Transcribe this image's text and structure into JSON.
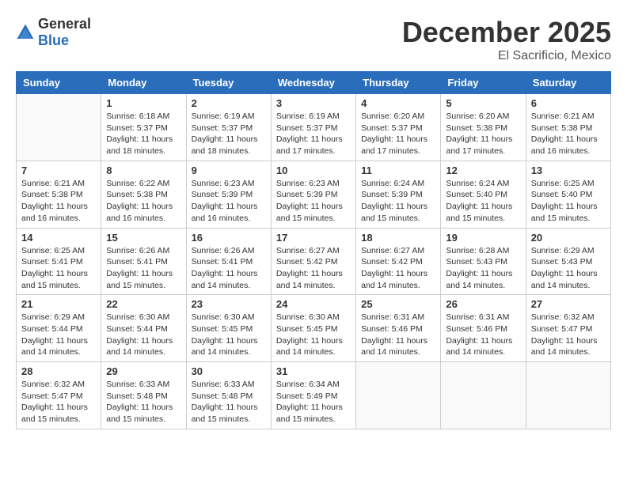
{
  "logo": {
    "text_general": "General",
    "text_blue": "Blue"
  },
  "title": {
    "month": "December 2025",
    "location": "El Sacrificio, Mexico"
  },
  "headers": [
    "Sunday",
    "Monday",
    "Tuesday",
    "Wednesday",
    "Thursday",
    "Friday",
    "Saturday"
  ],
  "weeks": [
    [
      {
        "day": "",
        "info": ""
      },
      {
        "day": "1",
        "info": "Sunrise: 6:18 AM\nSunset: 5:37 PM\nDaylight: 11 hours\nand 18 minutes."
      },
      {
        "day": "2",
        "info": "Sunrise: 6:19 AM\nSunset: 5:37 PM\nDaylight: 11 hours\nand 18 minutes."
      },
      {
        "day": "3",
        "info": "Sunrise: 6:19 AM\nSunset: 5:37 PM\nDaylight: 11 hours\nand 17 minutes."
      },
      {
        "day": "4",
        "info": "Sunrise: 6:20 AM\nSunset: 5:37 PM\nDaylight: 11 hours\nand 17 minutes."
      },
      {
        "day": "5",
        "info": "Sunrise: 6:20 AM\nSunset: 5:38 PM\nDaylight: 11 hours\nand 17 minutes."
      },
      {
        "day": "6",
        "info": "Sunrise: 6:21 AM\nSunset: 5:38 PM\nDaylight: 11 hours\nand 16 minutes."
      }
    ],
    [
      {
        "day": "7",
        "info": "Sunrise: 6:21 AM\nSunset: 5:38 PM\nDaylight: 11 hours\nand 16 minutes."
      },
      {
        "day": "8",
        "info": "Sunrise: 6:22 AM\nSunset: 5:38 PM\nDaylight: 11 hours\nand 16 minutes."
      },
      {
        "day": "9",
        "info": "Sunrise: 6:23 AM\nSunset: 5:39 PM\nDaylight: 11 hours\nand 16 minutes."
      },
      {
        "day": "10",
        "info": "Sunrise: 6:23 AM\nSunset: 5:39 PM\nDaylight: 11 hours\nand 15 minutes."
      },
      {
        "day": "11",
        "info": "Sunrise: 6:24 AM\nSunset: 5:39 PM\nDaylight: 11 hours\nand 15 minutes."
      },
      {
        "day": "12",
        "info": "Sunrise: 6:24 AM\nSunset: 5:40 PM\nDaylight: 11 hours\nand 15 minutes."
      },
      {
        "day": "13",
        "info": "Sunrise: 6:25 AM\nSunset: 5:40 PM\nDaylight: 11 hours\nand 15 minutes."
      }
    ],
    [
      {
        "day": "14",
        "info": "Sunrise: 6:25 AM\nSunset: 5:41 PM\nDaylight: 11 hours\nand 15 minutes."
      },
      {
        "day": "15",
        "info": "Sunrise: 6:26 AM\nSunset: 5:41 PM\nDaylight: 11 hours\nand 15 minutes."
      },
      {
        "day": "16",
        "info": "Sunrise: 6:26 AM\nSunset: 5:41 PM\nDaylight: 11 hours\nand 14 minutes."
      },
      {
        "day": "17",
        "info": "Sunrise: 6:27 AM\nSunset: 5:42 PM\nDaylight: 11 hours\nand 14 minutes."
      },
      {
        "day": "18",
        "info": "Sunrise: 6:27 AM\nSunset: 5:42 PM\nDaylight: 11 hours\nand 14 minutes."
      },
      {
        "day": "19",
        "info": "Sunrise: 6:28 AM\nSunset: 5:43 PM\nDaylight: 11 hours\nand 14 minutes."
      },
      {
        "day": "20",
        "info": "Sunrise: 6:29 AM\nSunset: 5:43 PM\nDaylight: 11 hours\nand 14 minutes."
      }
    ],
    [
      {
        "day": "21",
        "info": "Sunrise: 6:29 AM\nSunset: 5:44 PM\nDaylight: 11 hours\nand 14 minutes."
      },
      {
        "day": "22",
        "info": "Sunrise: 6:30 AM\nSunset: 5:44 PM\nDaylight: 11 hours\nand 14 minutes."
      },
      {
        "day": "23",
        "info": "Sunrise: 6:30 AM\nSunset: 5:45 PM\nDaylight: 11 hours\nand 14 minutes."
      },
      {
        "day": "24",
        "info": "Sunrise: 6:30 AM\nSunset: 5:45 PM\nDaylight: 11 hours\nand 14 minutes."
      },
      {
        "day": "25",
        "info": "Sunrise: 6:31 AM\nSunset: 5:46 PM\nDaylight: 11 hours\nand 14 minutes."
      },
      {
        "day": "26",
        "info": "Sunrise: 6:31 AM\nSunset: 5:46 PM\nDaylight: 11 hours\nand 14 minutes."
      },
      {
        "day": "27",
        "info": "Sunrise: 6:32 AM\nSunset: 5:47 PM\nDaylight: 11 hours\nand 14 minutes."
      }
    ],
    [
      {
        "day": "28",
        "info": "Sunrise: 6:32 AM\nSunset: 5:47 PM\nDaylight: 11 hours\nand 15 minutes."
      },
      {
        "day": "29",
        "info": "Sunrise: 6:33 AM\nSunset: 5:48 PM\nDaylight: 11 hours\nand 15 minutes."
      },
      {
        "day": "30",
        "info": "Sunrise: 6:33 AM\nSunset: 5:48 PM\nDaylight: 11 hours\nand 15 minutes."
      },
      {
        "day": "31",
        "info": "Sunrise: 6:34 AM\nSunset: 5:49 PM\nDaylight: 11 hours\nand 15 minutes."
      },
      {
        "day": "",
        "info": ""
      },
      {
        "day": "",
        "info": ""
      },
      {
        "day": "",
        "info": ""
      }
    ]
  ]
}
